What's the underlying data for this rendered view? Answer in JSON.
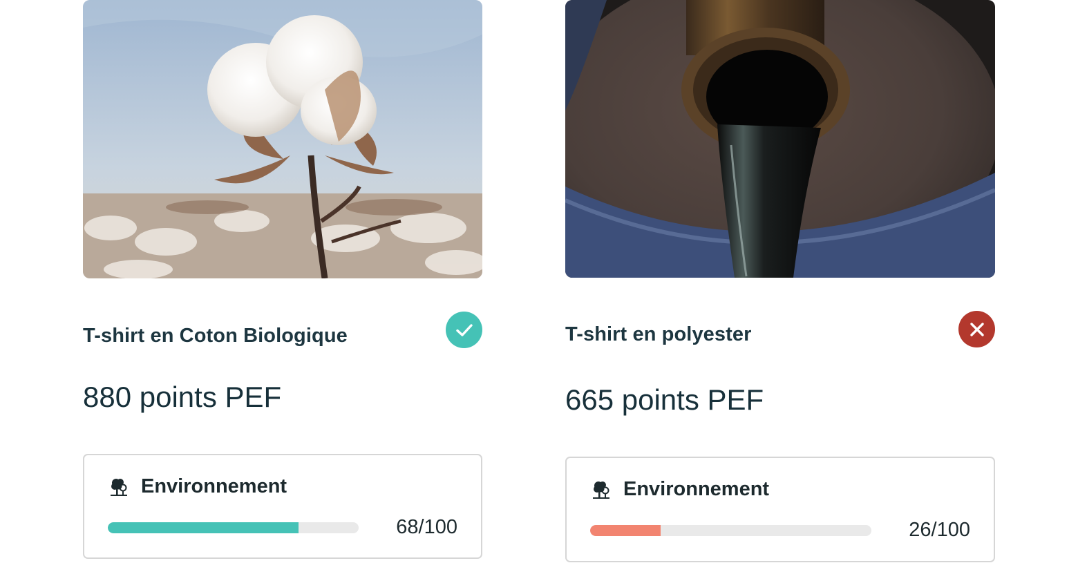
{
  "products": [
    {
      "title": "T-shirt en Coton Biologique",
      "status_icon": "check-icon",
      "status_color": "#45c2b6",
      "score_label": "880 points PEF",
      "category_label": "Environnement",
      "category_icon": "tree-icon",
      "bar_fraction": 0.76,
      "bar_color": "#45c2b6",
      "value_label": "68/100"
    },
    {
      "title": "T-shirt en polyester",
      "status_icon": "close-icon",
      "status_color": "#b3382d",
      "score_label": "665 points PEF",
      "category_label": "Environnement",
      "category_icon": "tree-icon",
      "bar_fraction": 0.25,
      "bar_color": "#f28470",
      "value_label": "26/100"
    }
  ]
}
